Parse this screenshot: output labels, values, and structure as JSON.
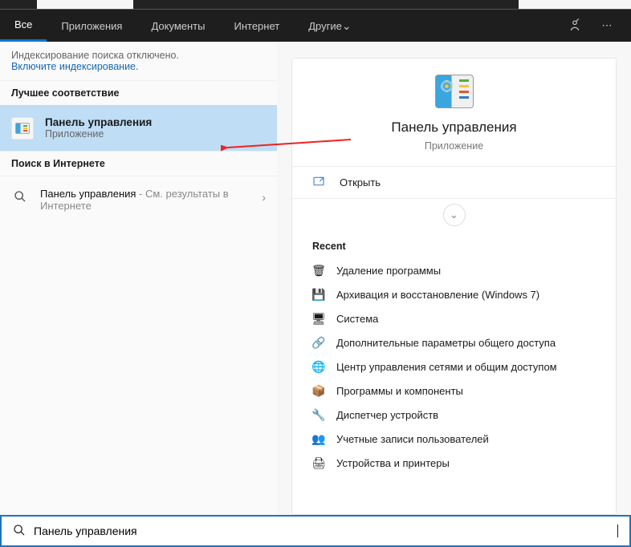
{
  "tabs": [
    "Все",
    "Приложения",
    "Документы",
    "Интернет",
    "Другие"
  ],
  "notice": {
    "line1": "Индексирование поиска отключено.",
    "link": "Включите индексирование"
  },
  "sections": {
    "best": "Лучшее соответствие",
    "web": "Поиск в Интернете"
  },
  "result": {
    "title": "Панель управления",
    "subtitle": "Приложение"
  },
  "webResult": {
    "strong": "Панель управления",
    "weak": " - См. результаты в Интернете"
  },
  "preview": {
    "title": "Панель управления",
    "subtitle": "Приложение"
  },
  "action": {
    "open": "Открыть"
  },
  "recent": {
    "title": "Recent",
    "items": [
      {
        "icon": "🗑",
        "label": "Удаление программы"
      },
      {
        "icon": "💾",
        "label": "Архивация и восстановление (Windows 7)"
      },
      {
        "icon": "🖥",
        "label": "Система"
      },
      {
        "icon": "🔗",
        "label": "Дополнительные параметры общего доступа"
      },
      {
        "icon": "🌐",
        "label": "Центр управления сетями и общим доступом"
      },
      {
        "icon": "📦",
        "label": "Программы и компоненты"
      },
      {
        "icon": "🔧",
        "label": "Диспетчер устройств"
      },
      {
        "icon": "👥",
        "label": "Учетные записи пользователей"
      },
      {
        "icon": "🖨",
        "label": "Устройства и принтеры"
      }
    ]
  },
  "search": {
    "value": "Панель управления"
  }
}
